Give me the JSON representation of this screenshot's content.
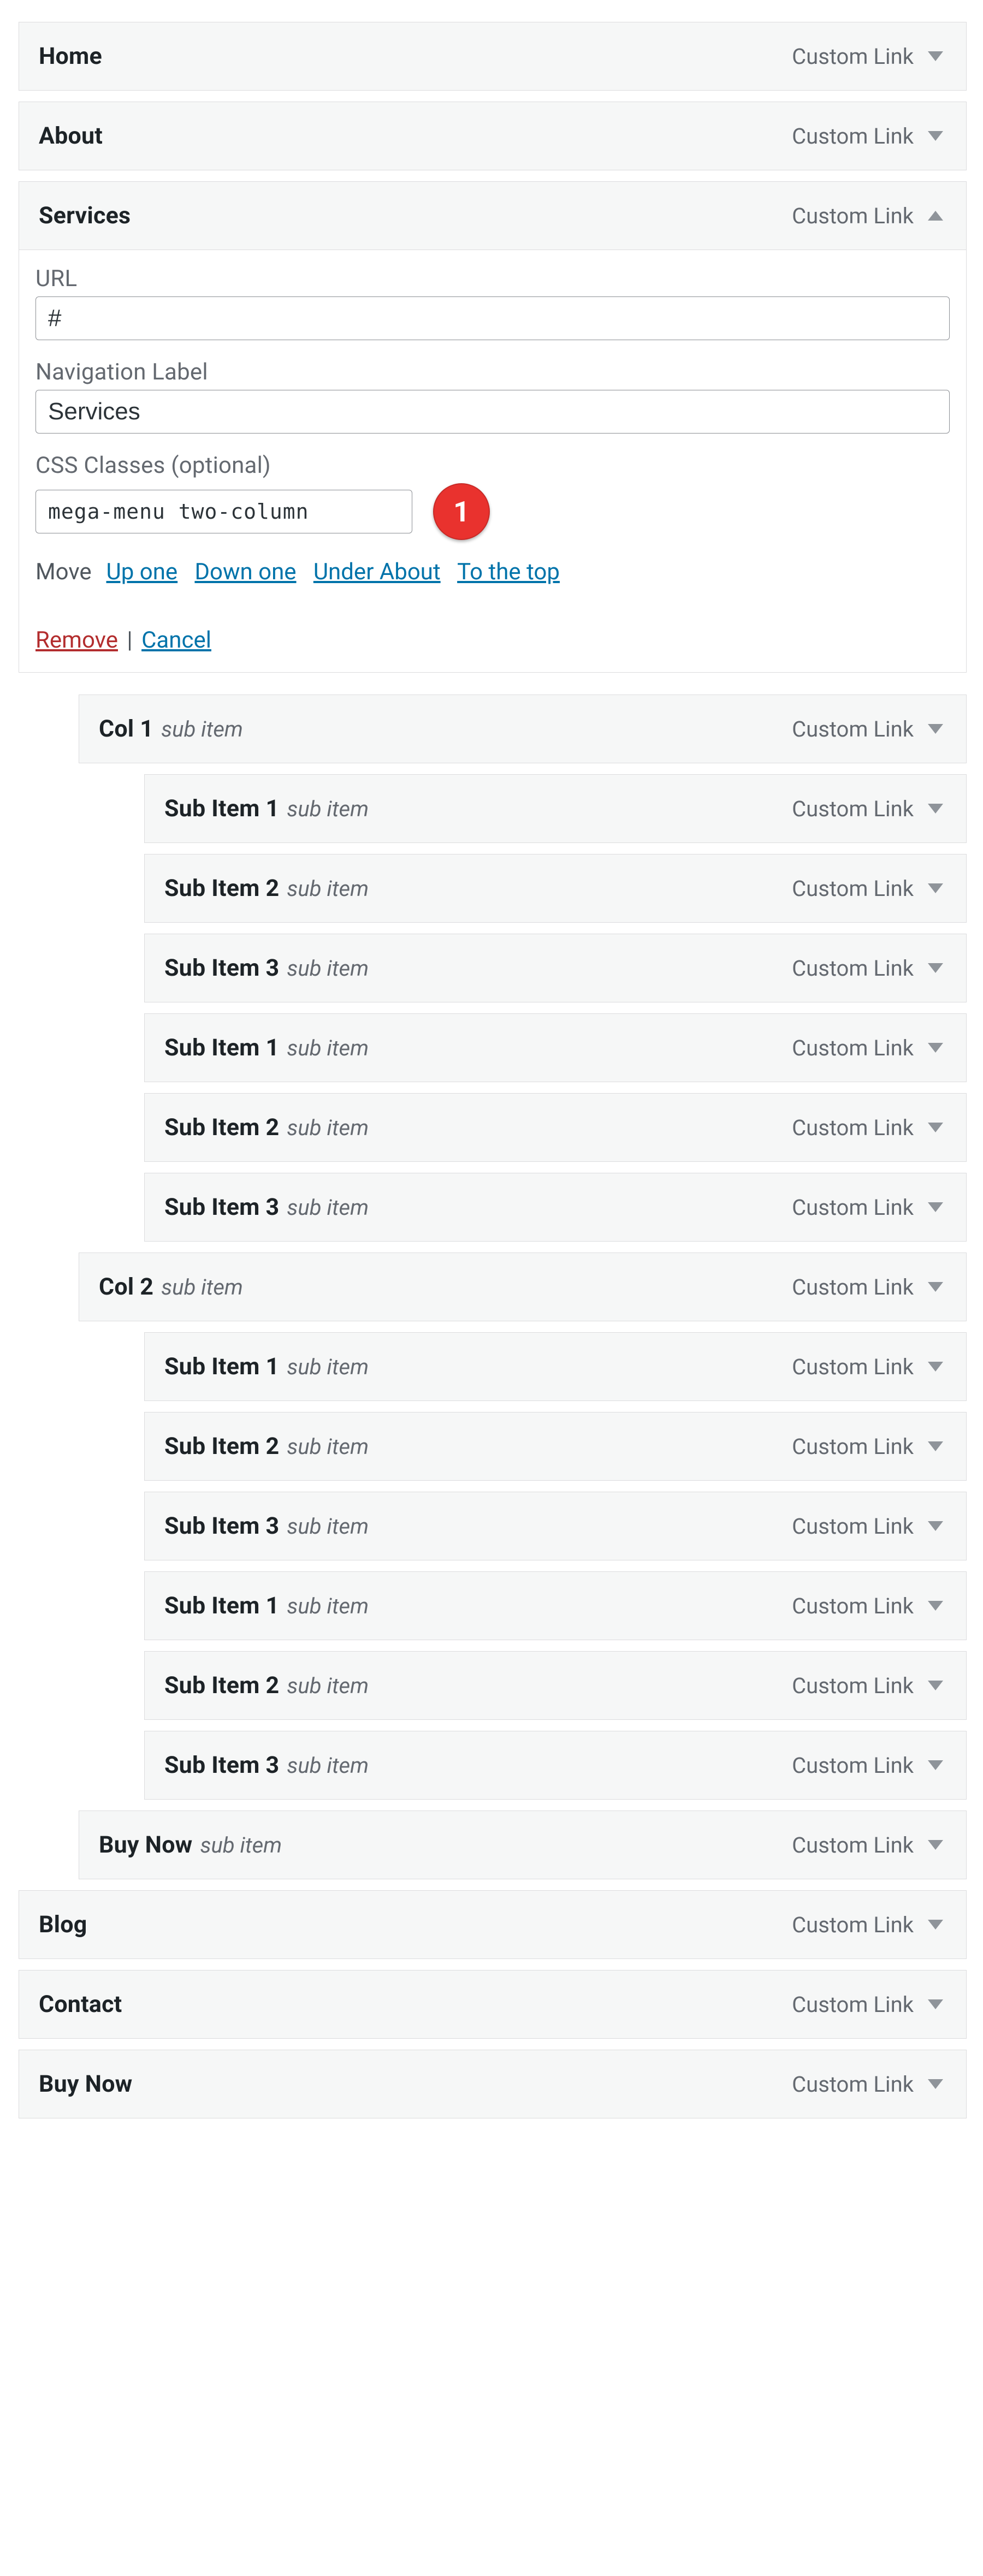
{
  "labels": {
    "url": "URL",
    "nav_label": "Navigation Label",
    "css_classes": "CSS Classes (optional)",
    "move": "Move",
    "remove": "Remove",
    "cancel": "Cancel"
  },
  "move_links": {
    "up": "Up one",
    "down": "Down one",
    "under": "Under About",
    "top": "To the top"
  },
  "expanded": {
    "url": "#",
    "nav_label": "Services",
    "css_classes": "mega-menu two-column",
    "badge": "1"
  },
  "items": [
    {
      "title": "Home",
      "type": "Custom Link",
      "depth": 0,
      "open": false
    },
    {
      "title": "About",
      "type": "Custom Link",
      "depth": 0,
      "open": false
    },
    {
      "title": "Services",
      "type": "Custom Link",
      "depth": 0,
      "open": true
    },
    {
      "title": "Col 1",
      "sub": "sub item",
      "type": "Custom Link",
      "depth": 1,
      "open": false
    },
    {
      "title": "Sub Item 1",
      "sub": "sub item",
      "type": "Custom Link",
      "depth": 2,
      "open": false
    },
    {
      "title": "Sub Item 2",
      "sub": "sub item",
      "type": "Custom Link",
      "depth": 2,
      "open": false
    },
    {
      "title": "Sub Item 3",
      "sub": "sub item",
      "type": "Custom Link",
      "depth": 2,
      "open": false
    },
    {
      "title": "Sub Item 1",
      "sub": "sub item",
      "type": "Custom Link",
      "depth": 2,
      "open": false
    },
    {
      "title": "Sub Item 2",
      "sub": "sub item",
      "type": "Custom Link",
      "depth": 2,
      "open": false
    },
    {
      "title": "Sub Item 3",
      "sub": "sub item",
      "type": "Custom Link",
      "depth": 2,
      "open": false
    },
    {
      "title": "Col 2",
      "sub": "sub item",
      "type": "Custom Link",
      "depth": 1,
      "open": false
    },
    {
      "title": "Sub Item 1",
      "sub": "sub item",
      "type": "Custom Link",
      "depth": 2,
      "open": false
    },
    {
      "title": "Sub Item 2",
      "sub": "sub item",
      "type": "Custom Link",
      "depth": 2,
      "open": false
    },
    {
      "title": "Sub Item 3",
      "sub": "sub item",
      "type": "Custom Link",
      "depth": 2,
      "open": false
    },
    {
      "title": "Sub Item 1",
      "sub": "sub item",
      "type": "Custom Link",
      "depth": 2,
      "open": false
    },
    {
      "title": "Sub Item 2",
      "sub": "sub item",
      "type": "Custom Link",
      "depth": 2,
      "open": false
    },
    {
      "title": "Sub Item 3",
      "sub": "sub item",
      "type": "Custom Link",
      "depth": 2,
      "open": false
    },
    {
      "title": "Buy Now",
      "sub": "sub item",
      "type": "Custom Link",
      "depth": 1,
      "open": false
    },
    {
      "title": "Blog",
      "type": "Custom Link",
      "depth": 0,
      "open": false
    },
    {
      "title": "Contact",
      "type": "Custom Link",
      "depth": 0,
      "open": false
    },
    {
      "title": "Buy Now",
      "type": "Custom Link",
      "depth": 0,
      "open": false
    }
  ]
}
